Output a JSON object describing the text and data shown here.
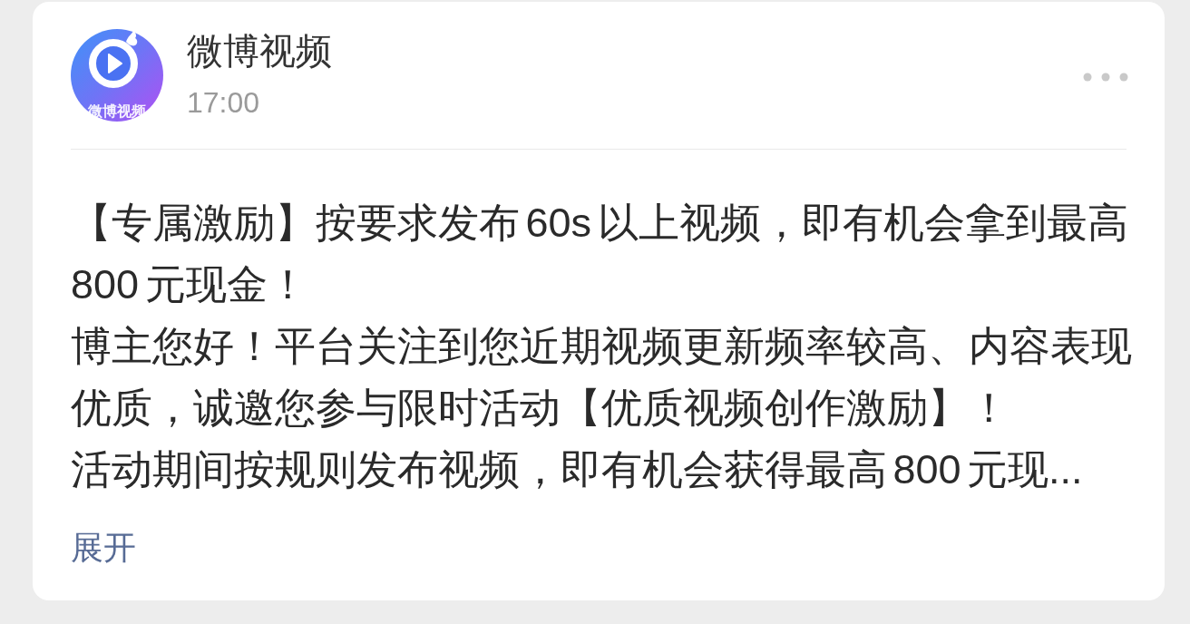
{
  "header": {
    "avatar_label": "微博视频",
    "sender": "微博视频",
    "time": "17:00"
  },
  "body": {
    "paragraphs": [
      "【专属激励】按要求发布 60s 以上视频，即有机会拿到最高 800 元现金！",
      "博主您好！平台关注到您近期视频更新频率较高、内容表现优质，诚邀您参与限时活动【优质视频创作激励】！",
      "活动期间按规则发布视频，即有机会获得最高 800 元现..."
    ]
  },
  "expand_link": "展开"
}
